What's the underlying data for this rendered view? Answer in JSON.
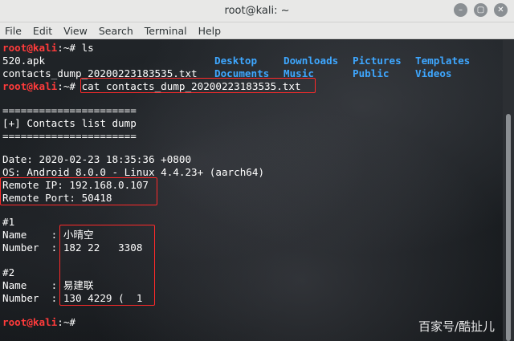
{
  "window": {
    "title": "root@kali: ~",
    "buttons": {
      "minimize": "–",
      "maximize": "▢",
      "close": "✕"
    }
  },
  "menu": [
    "File",
    "Edit",
    "View",
    "Search",
    "Terminal",
    "Help"
  ],
  "prompt": {
    "user": "root@kali",
    "path": ":~#"
  },
  "commands": {
    "ls": " ls",
    "cat": " cat contacts_dump_20200223183535.txt"
  },
  "ls_output": {
    "row1": {
      "c1": "520.apk",
      "c2": "Desktop",
      "c3": "Downloads",
      "c4": "Pictures",
      "c5": "Templates"
    },
    "row2": {
      "c1": "contacts_dump_20200223183535.txt",
      "c2": "Documents",
      "c3": "Music",
      "c4": "Public",
      "c5": "Videos"
    }
  },
  "dump": {
    "separator": "======================",
    "header": "[+] Contacts list dump",
    "date": "Date: 2020-02-23 18:35:36 +0800",
    "os": "OS: Android 8.0.0 - Linux 4.4.23+ (aarch64)",
    "remote_ip": "Remote IP: 192.168.0.107",
    "remote_port": "Remote Port: 50418",
    "contacts": [
      {
        "index": "#1",
        "name_label": "Name    : ",
        "name": "小晴空",
        "number_label": "Number  : ",
        "number": "182 22   3308"
      },
      {
        "index": "#2",
        "name_label": "Name    : ",
        "name": "易建联",
        "number_label": "Number  : ",
        "number": "130 4229 (  1"
      }
    ]
  },
  "watermark": "百家号/酷扯儿",
  "colors": {
    "prompt_user": "#ff3b3b",
    "directory": "#3ea7ff",
    "highlight": "#ff2a2a",
    "text": "#ffffff"
  }
}
